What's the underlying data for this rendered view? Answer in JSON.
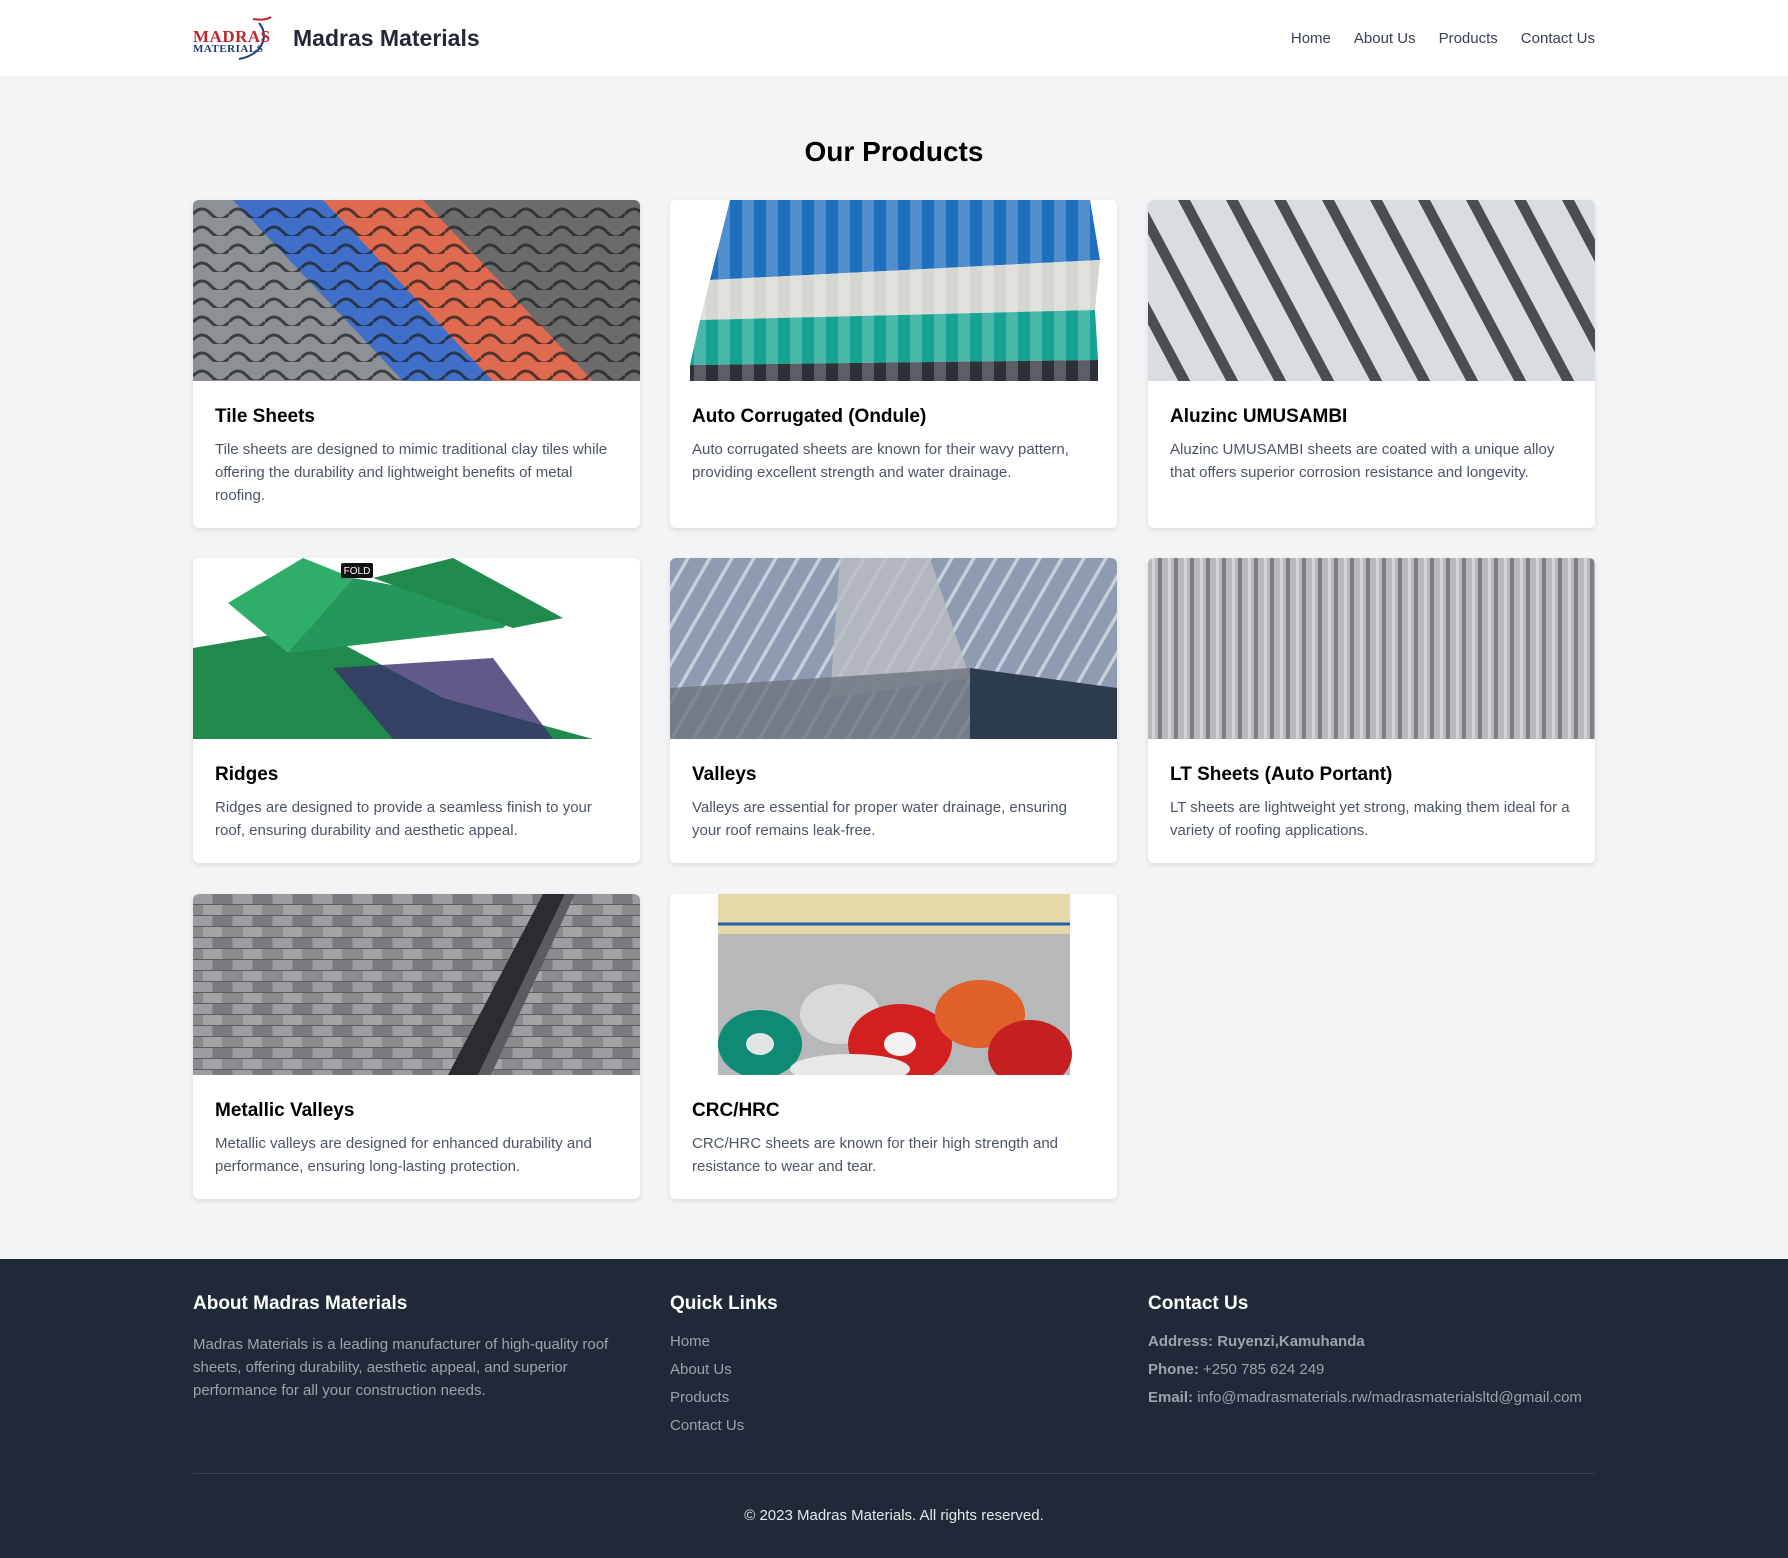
{
  "header": {
    "logo_line1": "MADRAS",
    "logo_line2": "MATERIALS",
    "site_title": "Madras Materials",
    "nav": [
      "Home",
      "About Us",
      "Products",
      "Contact Us"
    ]
  },
  "main": {
    "title": "Our Products",
    "products": [
      {
        "name": "Tile Sheets",
        "description": "Tile sheets are designed to mimic traditional clay tiles while offering the durability and lightweight benefits of metal roofing.",
        "image": "tile-sheets-photo"
      },
      {
        "name": "Auto Corrugated (Ondule)",
        "description": "Auto corrugated sheets are known for their wavy pattern, providing excellent strength and water drainage.",
        "image": "corrugated-sheets-photo"
      },
      {
        "name": "Aluzinc UMUSAMBI",
        "description": "Aluzinc UMUSAMBI sheets are coated with a unique alloy that offers superior corrosion resistance and longevity.",
        "image": "aluzinc-sheets-photo"
      },
      {
        "name": "Ridges",
        "description": "Ridges are designed to provide a seamless finish to your roof, ensuring durability and aesthetic appeal.",
        "image": "ridges-photo",
        "label": "FOLD"
      },
      {
        "name": "Valleys",
        "description": "Valleys are essential for proper water drainage, ensuring your roof remains leak-free.",
        "image": "valleys-photo"
      },
      {
        "name": "LT Sheets (Auto Portant)",
        "description": "LT sheets are lightweight yet strong, making them ideal for a variety of roofing applications.",
        "image": "lt-sheets-photo"
      },
      {
        "name": "Metallic Valleys",
        "description": "Metallic valleys are designed for enhanced durability and performance, ensuring long-lasting protection.",
        "image": "metallic-valleys-photo"
      },
      {
        "name": "CRC/HRC",
        "description": "CRC/HRC sheets are known for their high strength and resistance to wear and tear.",
        "image": "steel-coils-photo"
      }
    ]
  },
  "footer": {
    "about_title": "About Madras Materials",
    "about_text": "Madras Materials is a leading manufacturer of high-quality roof sheets, offering durability, aesthetic appeal, and superior performance for all your construction needs.",
    "links_title": "Quick Links",
    "links": [
      "Home",
      "About Us",
      "Products",
      "Contact Us"
    ],
    "contact_title": "Contact Us",
    "address_label": "Address:",
    "address_value": "Ruyenzi,Kamuhanda",
    "phone_label": "Phone:",
    "phone_value": "+250 785 624 249",
    "email_label": "Email:",
    "email_value": "info@madrasmaterials.rw/madrasmaterialsltd@gmail.com",
    "copyright": "© 2023 Madras Materials. All rights reserved."
  },
  "colors": {
    "background": "#f3f4f6",
    "footer": "#1f2937",
    "logo_red": "#c0272d",
    "logo_blue": "#1f3a7a"
  }
}
